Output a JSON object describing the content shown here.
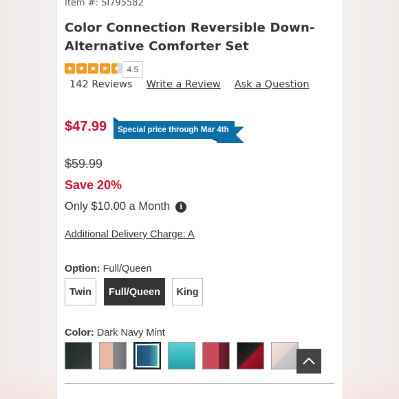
{
  "product": {
    "item_number": "Item #: SI795582",
    "title": "Color Connection Reversible Down-Alternative Comforter Set",
    "rating": {
      "stars": 4.5,
      "value_label": "4.5",
      "reviews_count_label": "142 Reviews",
      "write_review_label": "Write a Review",
      "ask_question_label": "Ask a Question"
    },
    "pricing": {
      "sale_price": "$47.99",
      "promo_ribbon": "Special price through Mar 4th",
      "original_price": "$59.99",
      "savings": "Save 20%",
      "monthly": "Only $10.00 a Month",
      "delivery_charge": "Additional Delivery Charge: A"
    },
    "option": {
      "label": "Option:",
      "selected_value": "Full/Queen",
      "choices": [
        "Twin",
        "Full/Queen",
        "King"
      ]
    },
    "color": {
      "label": "Color:",
      "selected_value": "Dark Navy Mint",
      "swatches": [
        {
          "name": "black-charcoal",
          "colors": [
            "#1f2a26",
            "#3a3f3d"
          ]
        },
        {
          "name": "blush-gray",
          "colors": [
            "#e9b9a4",
            "#8c8c8c"
          ]
        },
        {
          "name": "dark-navy-mint",
          "colors": [
            "#1f4d6e",
            "#5fc3b7"
          ]
        },
        {
          "name": "teal",
          "colors": [
            "#3bbcc0",
            "#2a9ca4"
          ]
        },
        {
          "name": "burgundy-pink",
          "colors": [
            "#c94a5a",
            "#7a1f33"
          ]
        },
        {
          "name": "black-red",
          "colors": [
            "#111111",
            "#a3122a"
          ]
        },
        {
          "name": "blush-silver",
          "colors": [
            "#e6d2cf",
            "#b9b9bd"
          ]
        }
      ]
    }
  },
  "theme": {
    "sale_red": "#c8102e",
    "ribbon_blue": "#0d6ea8",
    "star_orange": "#f29a1e",
    "dark": "#333333"
  },
  "icons": {
    "info": "info-icon",
    "scroll_top": "chevron-up-icon",
    "star": "star-icon"
  }
}
